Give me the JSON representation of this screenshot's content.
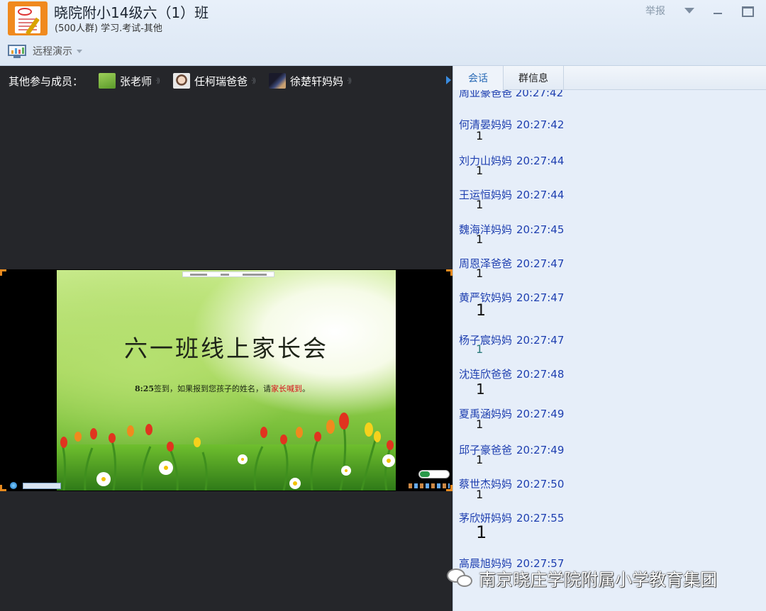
{
  "window": {
    "title": "晓院附小14级六（1）班",
    "subtitle": "(500人群) 学习.考试-其他",
    "report_label": "举报",
    "remote_label": "远程演示"
  },
  "members": {
    "label": "其他参与成员：",
    "items": [
      {
        "name": "张老师"
      },
      {
        "name": "任柯瑞爸爸"
      },
      {
        "name": "徐楚轩妈妈"
      }
    ]
  },
  "slide": {
    "title": "六一班线上家长会",
    "note_bold": "8:25",
    "note_text": "签到，如果报到您孩子的姓名，请",
    "note_red": "家长喊到",
    "note_end": "。"
  },
  "chat": {
    "tabs": [
      {
        "label": "会话"
      },
      {
        "label": "群信息"
      }
    ],
    "cut_header": "周亚豪爸爸 20:27:42",
    "messages": [
      {
        "sender": "何清晏妈妈",
        "time": "20:27:42",
        "text": "1"
      },
      {
        "sender": "刘力山妈妈",
        "time": "20:27:44",
        "text": "1"
      },
      {
        "sender": "王运恒妈妈",
        "time": "20:27:44",
        "text": "1"
      },
      {
        "sender": "魏海洋妈妈",
        "time": "20:27:45",
        "text": "1"
      },
      {
        "sender": "周恩泽爸爸",
        "time": "20:27:47",
        "text": "1"
      },
      {
        "sender": "黄严钦妈妈",
        "time": "20:27:47",
        "text": "1"
      },
      {
        "sender": "杨子宸妈妈",
        "time": "20:27:47",
        "text": "1"
      },
      {
        "sender": "沈连欣爸爸",
        "time": "20:27:48",
        "text": "1"
      },
      {
        "sender": "夏禹涵妈妈",
        "time": "20:27:49",
        "text": "1"
      },
      {
        "sender": "邱子豪爸爸",
        "time": "20:27:49",
        "text": "1"
      },
      {
        "sender": "蔡世杰妈妈",
        "time": "20:27:50",
        "text": "1"
      },
      {
        "sender": "茅欣妍妈妈",
        "time": "20:27:55",
        "text": "1"
      },
      {
        "sender": "高晨旭妈妈",
        "time": "20:27:57",
        "text": ""
      }
    ]
  },
  "watermark": {
    "text": "南京晓庄学院附属小学教育集团"
  },
  "colors": {
    "chat_name": "#1e3fb0",
    "frame_corner": "#e88a1e",
    "panel_bg": "#e6eef9",
    "present_bg": "#25262a"
  }
}
